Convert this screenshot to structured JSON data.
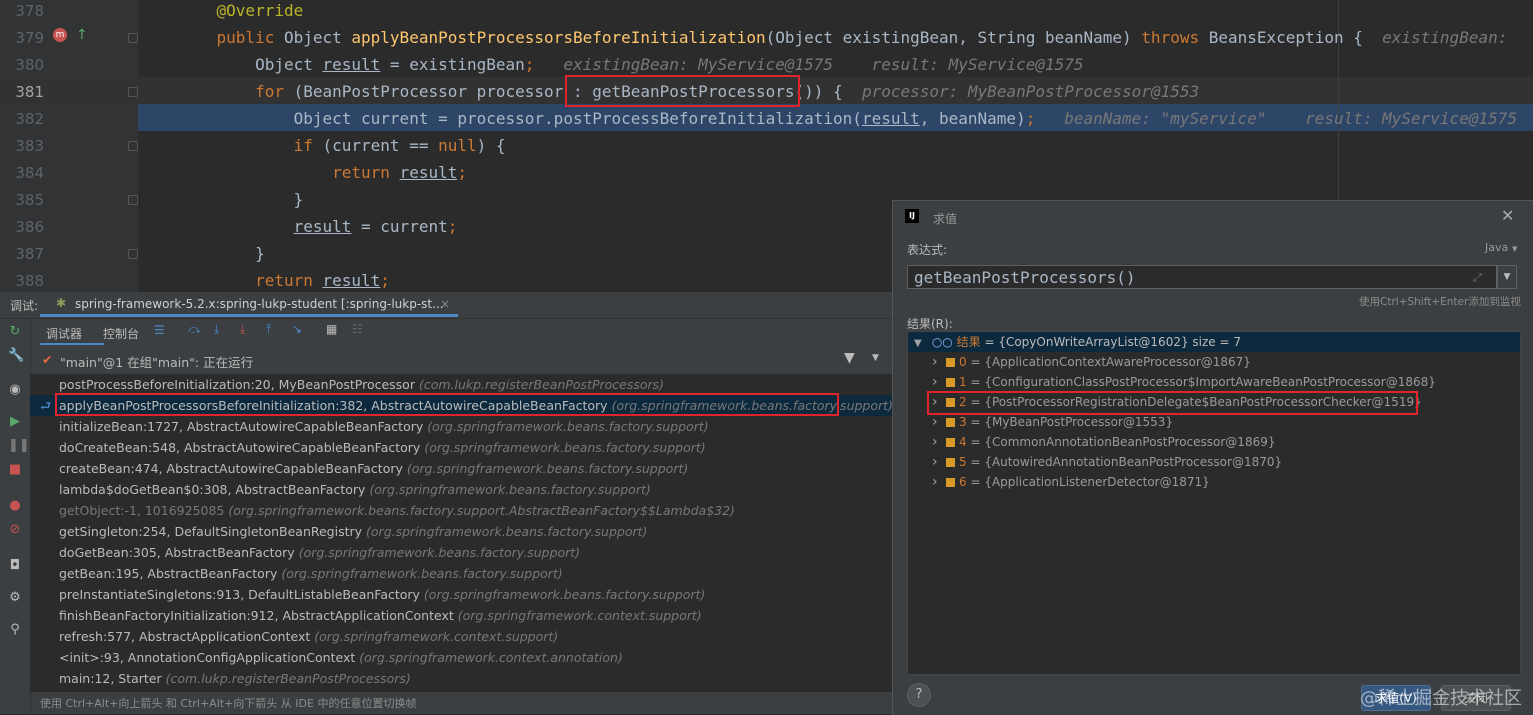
{
  "editor": {
    "lines": [
      {
        "num": "378",
        "parts": [
          {
            "t": "    @Override",
            "c": "ann"
          }
        ]
      },
      {
        "num": "379",
        "parts": [
          {
            "t": "    ",
            "c": ""
          },
          {
            "t": "public",
            "c": "kw"
          },
          {
            "t": " Object ",
            "c": ""
          },
          {
            "t": "applyBeanPostProcessorsBeforeInitialization",
            "c": "fn"
          },
          {
            "t": "(Object existingBean, String beanName) ",
            "c": ""
          },
          {
            "t": "throws",
            "c": "kw"
          },
          {
            "t": " BeansException {  ",
            "c": ""
          },
          {
            "t": "existingBean: ",
            "c": "hint"
          }
        ]
      },
      {
        "num": "380",
        "parts": [
          {
            "t": "        Object ",
            "c": ""
          },
          {
            "t": "result",
            "c": "ul"
          },
          {
            "t": " = existingBean",
            "c": ""
          },
          {
            "t": ";",
            "c": "kw"
          },
          {
            "t": "   existingBean: MyService@1575    result: MyService@1575",
            "c": "hint"
          }
        ]
      },
      {
        "num": "381",
        "parts": [
          {
            "t": "        ",
            "c": ""
          },
          {
            "t": "for",
            "c": "kw"
          },
          {
            "t": " (BeanPostProcessor processor : ",
            "c": ""
          },
          {
            "t": "getBeanPostProcessors()",
            "c": ""
          },
          {
            "t": ") {  ",
            "c": ""
          },
          {
            "t": "processor: MyBeanPostProcessor@1553",
            "c": "hint"
          }
        ]
      },
      {
        "num": "382",
        "parts": [
          {
            "t": "            Object current = processor.postProcessBeforeInitialization(",
            "c": ""
          },
          {
            "t": "result",
            "c": "ul"
          },
          {
            "t": ", beanName)",
            "c": ""
          },
          {
            "t": ";",
            "c": "kw"
          },
          {
            "t": "   beanName: \"myService\"    result: MyService@1575",
            "c": "hint"
          }
        ]
      },
      {
        "num": "383",
        "parts": [
          {
            "t": "            ",
            "c": ""
          },
          {
            "t": "if",
            "c": "kw"
          },
          {
            "t": " (current == ",
            "c": ""
          },
          {
            "t": "null",
            "c": "kw"
          },
          {
            "t": ") {",
            "c": ""
          }
        ]
      },
      {
        "num": "384",
        "parts": [
          {
            "t": "                ",
            "c": ""
          },
          {
            "t": "return",
            "c": "kw"
          },
          {
            "t": " ",
            "c": ""
          },
          {
            "t": "result",
            "c": "ul"
          },
          {
            "t": ";",
            "c": "kw"
          }
        ]
      },
      {
        "num": "385",
        "parts": [
          {
            "t": "            }",
            "c": ""
          }
        ]
      },
      {
        "num": "386",
        "parts": [
          {
            "t": "            ",
            "c": ""
          },
          {
            "t": "result",
            "c": "ul"
          },
          {
            "t": " = current",
            "c": ""
          },
          {
            "t": ";",
            "c": "kw"
          }
        ]
      },
      {
        "num": "387",
        "parts": [
          {
            "t": "        }",
            "c": ""
          }
        ]
      },
      {
        "num": "388",
        "parts": [
          {
            "t": "        ",
            "c": ""
          },
          {
            "t": "return",
            "c": "kw"
          },
          {
            "t": " ",
            "c": ""
          },
          {
            "t": "result",
            "c": "ul"
          },
          {
            "t": ";",
            "c": "kw"
          }
        ]
      }
    ]
  },
  "debug": {
    "title_label": "调试:",
    "session_tab": "spring-framework-5.2.x:spring-lukp-student [:spring-lukp-st...",
    "tab_debugger": "调试器",
    "tab_console": "控制台",
    "thread": "\"main\"@1 在组\"main\": 正在运行",
    "status_hint": "使用 Ctrl+Alt+向上箭头 和 Ctrl+Alt+向下箭头 从 IDE 中的任意位置切换帧",
    "frames": [
      {
        "method": "postProcessBeforeInitialization:20, MyBeanPostProcessor",
        "pkg": "(com.lukp.registerBeanPostProcessors)"
      },
      {
        "method": "applyBeanPostProcessorsBeforeInitialization:382, AbstractAutowireCapableBeanFactory",
        "pkg": "(org.springframework.beans.factory.support)"
      },
      {
        "method": "initializeBean:1727, AbstractAutowireCapableBeanFactory",
        "pkg": "(org.springframework.beans.factory.support)"
      },
      {
        "method": "doCreateBean:548, AbstractAutowireCapableBeanFactory",
        "pkg": "(org.springframework.beans.factory.support)"
      },
      {
        "method": "createBean:474, AbstractAutowireCapableBeanFactory",
        "pkg": "(org.springframework.beans.factory.support)"
      },
      {
        "method": "lambda$doGetBean$0:308, AbstractBeanFactory",
        "pkg": "(org.springframework.beans.factory.support)"
      },
      {
        "method": "getObject:-1, 1016925085",
        "pkg": "(org.springframework.beans.factory.support.AbstractBeanFactory$$Lambda$32)"
      },
      {
        "method": "getSingleton:254, DefaultSingletonBeanRegistry",
        "pkg": "(org.springframework.beans.factory.support)"
      },
      {
        "method": "doGetBean:305, AbstractBeanFactory",
        "pkg": "(org.springframework.beans.factory.support)"
      },
      {
        "method": "getBean:195, AbstractBeanFactory",
        "pkg": "(org.springframework.beans.factory.support)"
      },
      {
        "method": "preInstantiateSingletons:913, DefaultListableBeanFactory",
        "pkg": "(org.springframework.beans.factory.support)"
      },
      {
        "method": "finishBeanFactoryInitialization:912, AbstractApplicationContext",
        "pkg": "(org.springframework.context.support)"
      },
      {
        "method": "refresh:577, AbstractApplicationContext",
        "pkg": "(org.springframework.context.support)"
      },
      {
        "method": "<init>:93, AnnotationConfigApplicationContext",
        "pkg": "(org.springframework.context.annotation)"
      },
      {
        "method": "main:12, Starter",
        "pkg": "(com.lukp.registerBeanPostProcessors)"
      }
    ]
  },
  "evaluate": {
    "title": "求值",
    "expr_label": "表达式:",
    "language": "Java",
    "expression": "getBeanPostProcessors()",
    "watch_hint": "使用Ctrl+Shift+Enter添加到监视",
    "result_label": "结果(R):",
    "root_label": "结果",
    "root_value": "= {CopyOnWriteArrayList@1602}  size = 7",
    "items": [
      {
        "idx": "0",
        "value": "= {ApplicationContextAwareProcessor@1867}"
      },
      {
        "idx": "1",
        "value": "= {ConfigurationClassPostProcessor$ImportAwareBeanPostProcessor@1868}"
      },
      {
        "idx": "2",
        "value": "= {PostProcessorRegistrationDelegate$BeanPostProcessorChecker@1519}"
      },
      {
        "idx": "3",
        "value": "= {MyBeanPostProcessor@1553}"
      },
      {
        "idx": "4",
        "value": "= {CommonAnnotationBeanPostProcessor@1869}"
      },
      {
        "idx": "5",
        "value": "= {AutowiredAnnotationBeanPostProcessor@1870}"
      },
      {
        "idx": "6",
        "value": "= {ApplicationListenerDetector@1871}"
      }
    ],
    "help": "?",
    "eval_button": "求值(V)",
    "close_button": "关闭"
  },
  "watermark": "@稀土掘金技术社区"
}
